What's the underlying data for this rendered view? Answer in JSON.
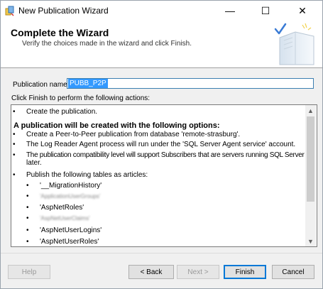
{
  "window": {
    "title": "New Publication Wizard",
    "minimize_glyph": "—",
    "maximize_glyph": "☐",
    "close_glyph": "✕"
  },
  "header": {
    "title": "Complete the Wizard",
    "subtitle": "Verify the choices made in the wizard and click Finish."
  },
  "publication": {
    "label": "Publication name:",
    "value": "PUBB_P2P"
  },
  "instruction": "Click Finish to perform the following actions:",
  "actions": {
    "create": "Create the publication.",
    "heading": "A publication will be created with the following options:",
    "options": [
      "Create a Peer-to-Peer publication from database 'remote-strasburg'.",
      "The Log Reader Agent process will run under the 'SQL Server Agent service' account.",
      "The publication compatibility level will support Subscribers that are servers running SQL Server 2008 or",
      "later.",
      "Publish the following tables as articles:"
    ],
    "articles": [
      "'__MigrationHistory'",
      "'ApplicationUserGroups'",
      "'AspNetRoles'",
      "'AspNetUserClaims'",
      "'AspNetUserLogins'",
      "'AspNetUserRoles'"
    ]
  },
  "buttons": {
    "help": "Help",
    "back": "< Back",
    "next": "Next >",
    "finish": "Finish",
    "cancel": "Cancel"
  },
  "colors": {
    "accent": "#0078d7",
    "selection": "#3399ff"
  }
}
